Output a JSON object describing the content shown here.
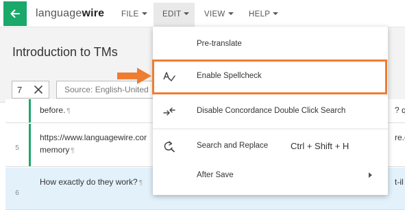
{
  "app": {
    "logo_light": "language",
    "logo_bold": "wire"
  },
  "menubar": {
    "file": "FILE",
    "edit": "EDIT",
    "view": "VIEW",
    "help": "HELP"
  },
  "page": {
    "title": "Introduction to TMs"
  },
  "filters": {
    "segment_value": "7",
    "source_placeholder": "Source: English-United"
  },
  "grid": {
    "rows": [
      {
        "num": "",
        "line1": "before.",
        "pilcrow": "¶",
        "right": "? qu"
      },
      {
        "num": "5",
        "line1": "https://www.languagewire.cor",
        "line2": "memory",
        "pilcrow": "¶",
        "right": "re.co"
      },
      {
        "num": "6",
        "line1": "How exactly do they work?",
        "pilcrow": "¶",
        "right": "t-il"
      }
    ]
  },
  "edit_menu": {
    "items": [
      {
        "label": "Pre-translate"
      },
      {
        "label": "Enable Spellcheck",
        "icon": "spellcheck-icon"
      },
      {
        "label": "Disable Concordance Double Click Search",
        "icon": "concordance-icon"
      },
      {
        "label": "Search and Replace",
        "icon": "search-replace-icon",
        "shortcut": "Ctrl + Shift + H"
      },
      {
        "label": "After Save",
        "submenu": true
      }
    ]
  },
  "colors": {
    "brand_green": "#1ba86b",
    "highlight_orange": "#ee7d31"
  }
}
